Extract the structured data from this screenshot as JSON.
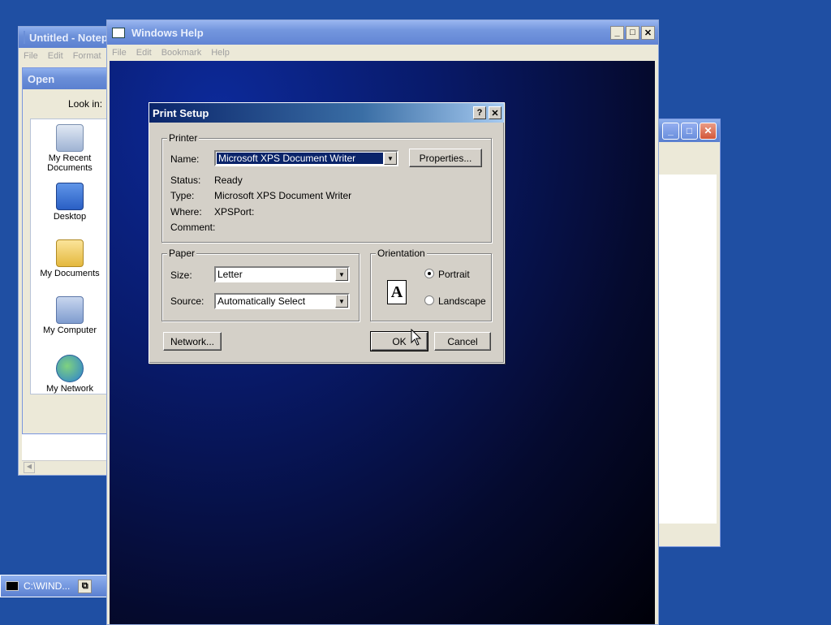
{
  "notepad": {
    "title": "Untitled - Notepad",
    "menu": [
      "File",
      "Edit",
      "Format"
    ]
  },
  "open_dialog": {
    "title": "Open",
    "look_in_label": "Look in:",
    "places": [
      {
        "label": "My Recent Documents",
        "icon": "recent-documents-icon"
      },
      {
        "label": "Desktop",
        "icon": "desktop-icon"
      },
      {
        "label": "My Documents",
        "icon": "my-documents-icon"
      },
      {
        "label": "My Computer",
        "icon": "my-computer-icon"
      },
      {
        "label": "My Network",
        "icon": "my-network-icon"
      }
    ]
  },
  "help_window": {
    "title": "Windows Help",
    "menu": [
      "File",
      "Edit",
      "Bookmark",
      "Help"
    ]
  },
  "print_setup": {
    "title": "Print Setup",
    "printer_group": "Printer",
    "name_label": "Name:",
    "name_value": "Microsoft XPS Document Writer",
    "properties_button": "Properties...",
    "status_label": "Status:",
    "status_value": "Ready",
    "type_label": "Type:",
    "type_value": "Microsoft XPS Document Writer",
    "where_label": "Where:",
    "where_value": "XPSPort:",
    "comment_label": "Comment:",
    "comment_value": "",
    "paper_group": "Paper",
    "size_label": "Size:",
    "size_value": "Letter",
    "source_label": "Source:",
    "source_value": "Automatically Select",
    "orientation_group": "Orientation",
    "portrait_label": "Portrait",
    "landscape_label": "Landscape",
    "orientation_selected": "Portrait",
    "orientation_preview_letter": "A",
    "network_button": "Network...",
    "ok_button": "OK",
    "cancel_button": "Cancel"
  },
  "taskbar_item": {
    "label": "C:\\WIND..."
  },
  "colors": {
    "desktop": "#1f4fa3",
    "selection": "#0a246a",
    "dialog_face": "#d4d0c8"
  }
}
